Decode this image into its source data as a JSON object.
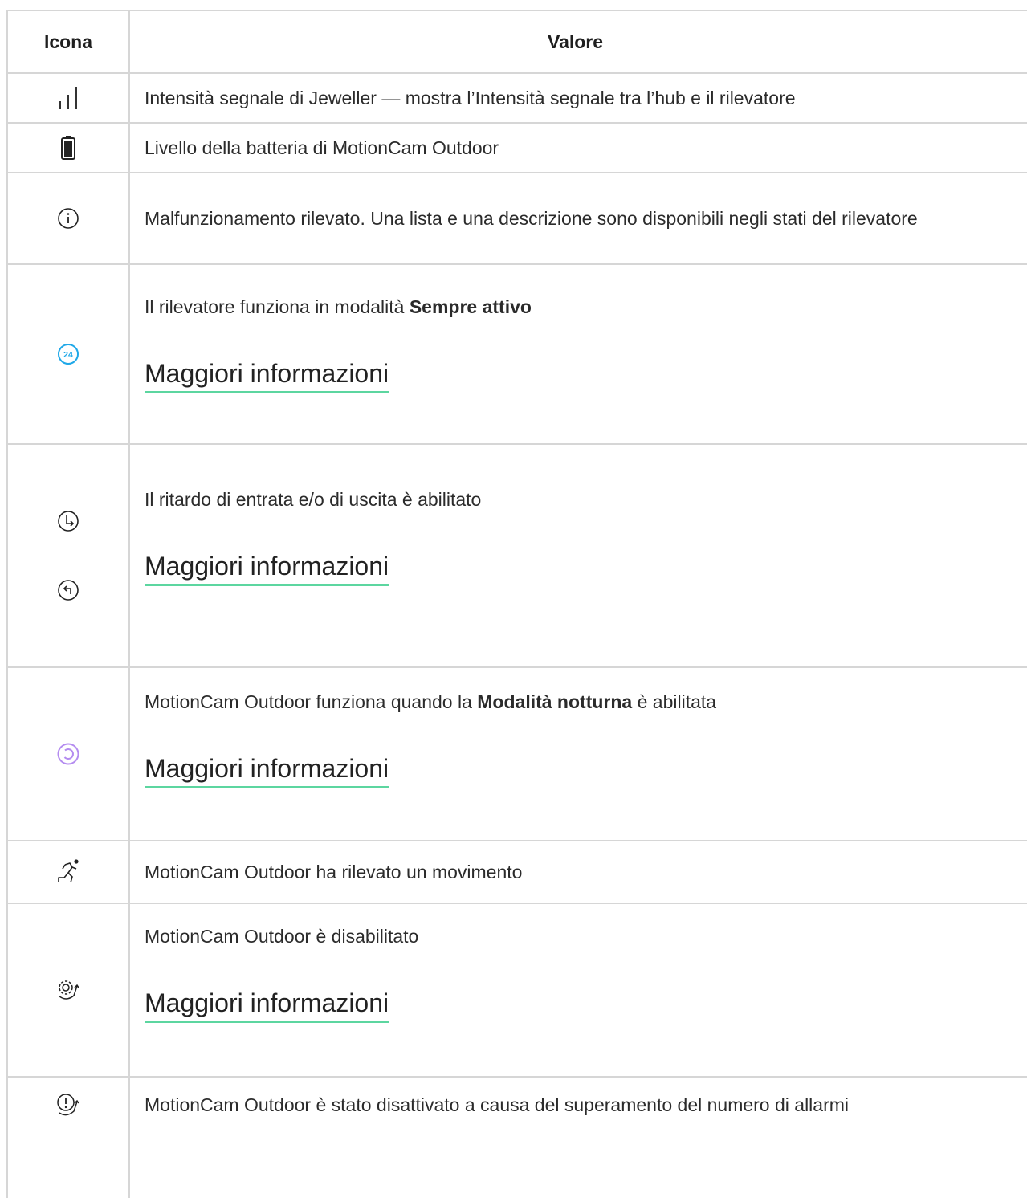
{
  "table": {
    "headers": {
      "icon": "Icona",
      "value": "Valore"
    },
    "rows": [
      {
        "icon": "signal-strength-icon",
        "text": "Intensità segnale di Jeweller — mostra l’Intensità segnale tra l’hub e il rilevatore"
      },
      {
        "icon": "battery-icon",
        "text": "Livello della batteria di MotionCam Outdoor"
      },
      {
        "icon": "info-icon",
        "text": "Malfunzionamento rilevato. Una lista e una descrizione sono disponibili negli stati del rilevatore"
      },
      {
        "icon": "always-active-24-icon",
        "text_before": "Il rilevatore funziona in modalità ",
        "text_bold": "Sempre attivo",
        "text_after": "",
        "more": "Maggiori informazioni",
        "icon_label": "24"
      },
      {
        "icon": "entry-delay-icon",
        "icon2": "exit-delay-icon",
        "text": "Il ritardo di entrata e/o di uscita è abilitato",
        "more": "Maggiori informazioni"
      },
      {
        "icon": "night-mode-icon",
        "text_before": "MotionCam Outdoor funziona quando la ",
        "text_bold": "Modalità notturna",
        "text_after": " è abilitata",
        "more": "Maggiori informazioni"
      },
      {
        "icon": "motion-detected-icon",
        "text": "MotionCam Outdoor ha rilevato un movimento"
      },
      {
        "icon": "device-disabled-icon",
        "text": "MotionCam Outdoor è disabilitato",
        "more": "Maggiori informazioni"
      },
      {
        "icon": "auto-deactivated-icon",
        "text": "MotionCam Outdoor è stato disattivato a causa del superamento del numero di allarmi"
      }
    ]
  },
  "colors": {
    "border": "#d6d6d6",
    "link_underline": "#5cd6a0",
    "always_active_icon": "#1fa8e8",
    "night_mode_icon": "#b48cf0"
  }
}
